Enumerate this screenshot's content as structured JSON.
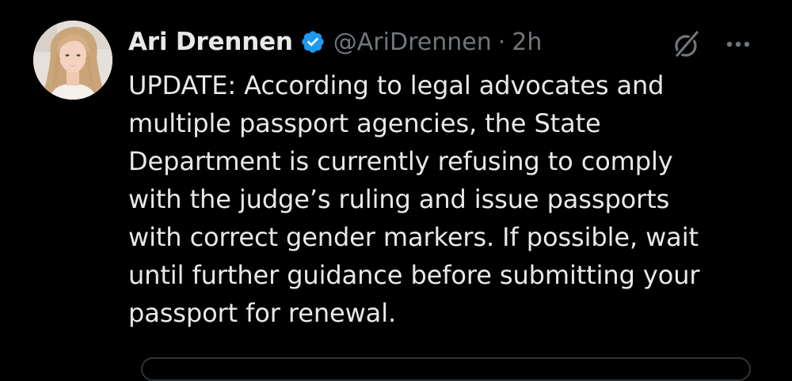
{
  "tweet": {
    "author": {
      "display_name": "Ari Drennen",
      "handle": "@AriDrennen",
      "verified": true,
      "verified_color": "#1d9bf0"
    },
    "separator": "·",
    "timestamp": "2h",
    "icons": {
      "grok": "grok-icon",
      "more": "more-options-icon",
      "verified": "verified-badge-icon"
    },
    "body_lines": [
      "UPDATE: According to legal advocates and",
      "multiple passport agencies, the State",
      "Department is currently refusing to comply",
      "with the judge’s ruling and issue passports",
      "with correct gender markers. If possible, wait",
      "until further guidance before submitting your",
      "passport for renewal."
    ]
  },
  "colors": {
    "background": "#000000",
    "primary_text": "#e7e9ea",
    "secondary_text": "#71767b",
    "accent": "#1d9bf0"
  }
}
